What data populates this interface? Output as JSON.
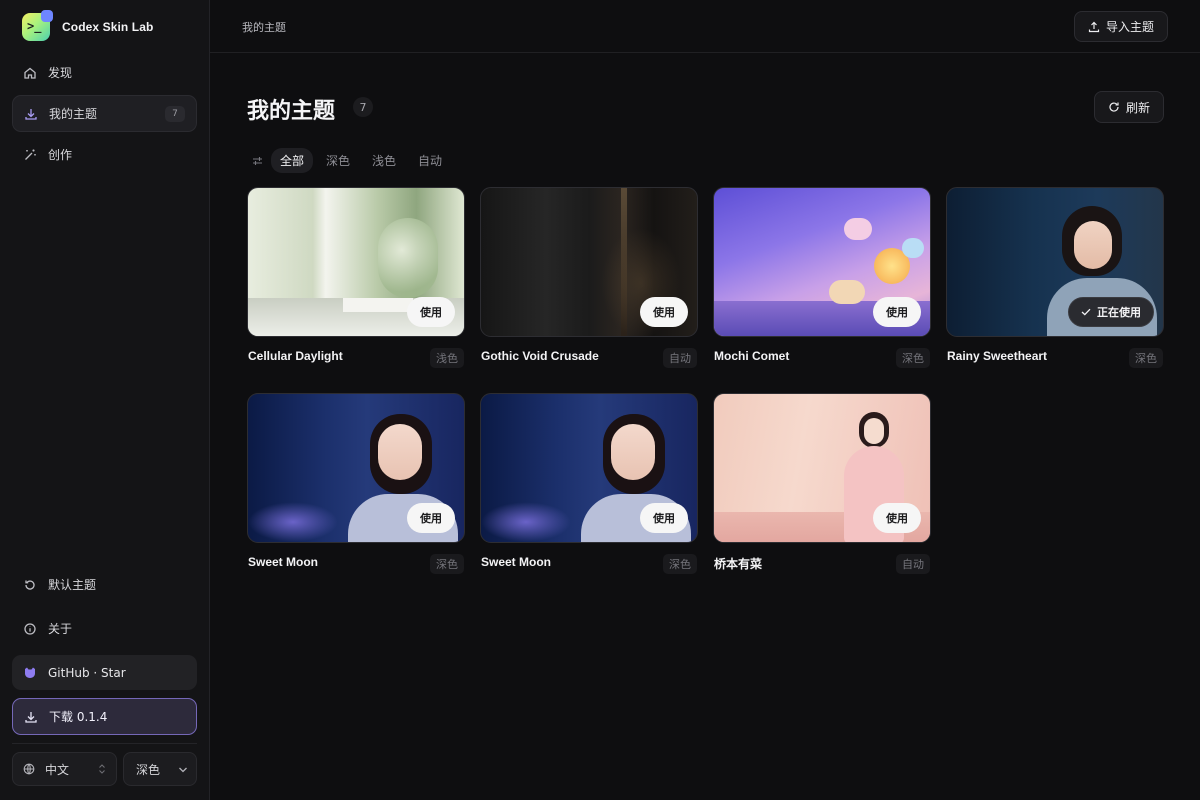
{
  "app": {
    "name": "Codex Skin Lab",
    "logo_glyph": ">_"
  },
  "sidebar": {
    "nav": [
      {
        "label": "发现",
        "icon": "home-icon"
      },
      {
        "label": "我的主题",
        "icon": "download-icon",
        "count": "7",
        "active": true
      },
      {
        "label": "创作",
        "icon": "magic-wand-icon"
      }
    ],
    "default_theme": "默认主题",
    "about": "关于",
    "github": "GitHub · Star",
    "download": "下载 0.1.4",
    "language": "中文",
    "mode": "深色"
  },
  "header": {
    "breadcrumb": "我的主题",
    "import_label": "导入主题"
  },
  "page": {
    "title": "我的主题",
    "count": "7",
    "refresh_label": "刷新"
  },
  "filters": [
    "全部",
    "深色",
    "浅色",
    "自动"
  ],
  "filter_selected": "全部",
  "cards": [
    {
      "name": "Cellular Daylight",
      "tag": "浅色",
      "action": "使用"
    },
    {
      "name": "Gothic Void Crusade",
      "tag": "自动",
      "action": "使用"
    },
    {
      "name": "Mochi Comet",
      "tag": "深色",
      "action": "使用"
    },
    {
      "name": "Rainy Sweetheart",
      "tag": "深色",
      "action": "正在使用"
    },
    {
      "name": "Sweet Moon",
      "tag": "深色",
      "action": "使用"
    },
    {
      "name": "Sweet Moon",
      "tag": "深色",
      "action": "使用"
    },
    {
      "name": "桥本有菜",
      "tag": "自动",
      "action": "使用"
    }
  ],
  "colors": {
    "background": "#0e0e10",
    "sidebar": "#141416",
    "accent": "#7568b8",
    "card_border": "#2d2d32"
  }
}
